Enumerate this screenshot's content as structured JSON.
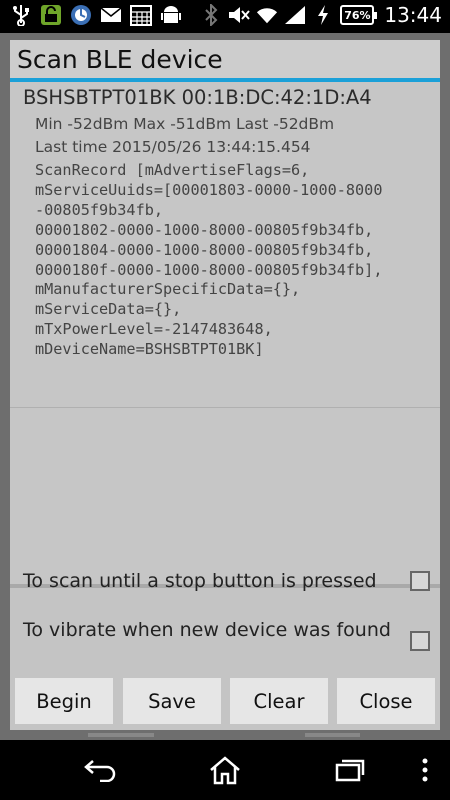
{
  "status_bar": {
    "time": "13:44",
    "battery": "76%",
    "icons": [
      "usb-icon",
      "lock-icon",
      "sync-icon",
      "mail-icon",
      "calendar-icon",
      "android-icon",
      "bluetooth-icon",
      "mute-icon",
      "wifi-icon",
      "signal-icon",
      "charging-icon"
    ]
  },
  "dialog": {
    "title": "Scan BLE device",
    "accent_color": "#1ba0d8",
    "devices": [
      {
        "name_line": "BSHSBTPT01BK  00:1B:DC:42:1D:A4",
        "rssi_line": "Min  -52dBm  Max -51dBm  Last -52dBm",
        "time_line": "Last time 2015/05/26 13:44:15.454",
        "scan_record": "ScanRecord [mAdvertiseFlags=6,\nmServiceUuids=[00001803-0000-1000-8000\n-00805f9b34fb,\n00001802-0000-1000-8000-00805f9b34fb,\n00001804-0000-1000-8000-00805f9b34fb,\n0000180f-0000-1000-8000-00805f9b34fb],\nmManufacturerSpecificData={},\nmServiceData={},\nmTxPowerLevel=-2147483648,\nmDeviceName=BSHSBTPT01BK]"
      }
    ],
    "options": {
      "scan_until_stop": {
        "label": "To scan until a stop button is pressed",
        "checked": false
      },
      "vibrate_new_device": {
        "label": "To vibrate when new device was found",
        "checked": false
      }
    },
    "buttons": {
      "begin": "Begin",
      "save": "Save",
      "clear": "Clear",
      "close": "Close"
    }
  },
  "nav_bar": {
    "buttons": [
      "back-icon",
      "home-icon",
      "recent-apps-icon",
      "menu-icon"
    ]
  }
}
